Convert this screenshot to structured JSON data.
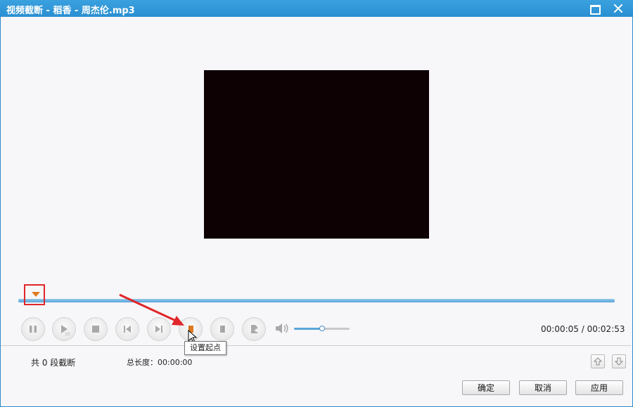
{
  "window": {
    "title": "视频截断 - 稻香 - 周杰伦.mp3",
    "maximize_icon": "maximize-icon",
    "close_icon": "close-icon"
  },
  "player": {
    "video_color": "#0d0103",
    "timeline_color": "#5aa6d9",
    "controls": [
      {
        "name": "pause-button",
        "icon": "pause-icon"
      },
      {
        "name": "play-segment-button",
        "icon": "play-segment-icon"
      },
      {
        "name": "stop-button",
        "icon": "stop-icon"
      },
      {
        "name": "previous-frame-button",
        "icon": "skip-back-icon"
      },
      {
        "name": "next-frame-button",
        "icon": "skip-forward-icon"
      },
      {
        "name": "set-start-button",
        "icon": "set-start-icon"
      },
      {
        "name": "set-end-button",
        "icon": "set-end-icon"
      },
      {
        "name": "add-segment-button",
        "icon": "add-segment-icon"
      }
    ],
    "volume_level": 0.5,
    "current_time": "00:00:05",
    "total_time": "00:02:53",
    "time_separator": " / "
  },
  "tooltip": {
    "text": "设置起点"
  },
  "segments": {
    "prefix": "共 ",
    "count": "0",
    "suffix": " 段截断",
    "total_length_label": "总长度：",
    "total_length_value": "00:00:00"
  },
  "buttons": {
    "move_up_icon": "move-up-icon",
    "move_down_icon": "move-down-icon",
    "ok": "确定",
    "cancel": "取消",
    "apply": "应用"
  },
  "annotation": {
    "color": "#e0262a"
  }
}
